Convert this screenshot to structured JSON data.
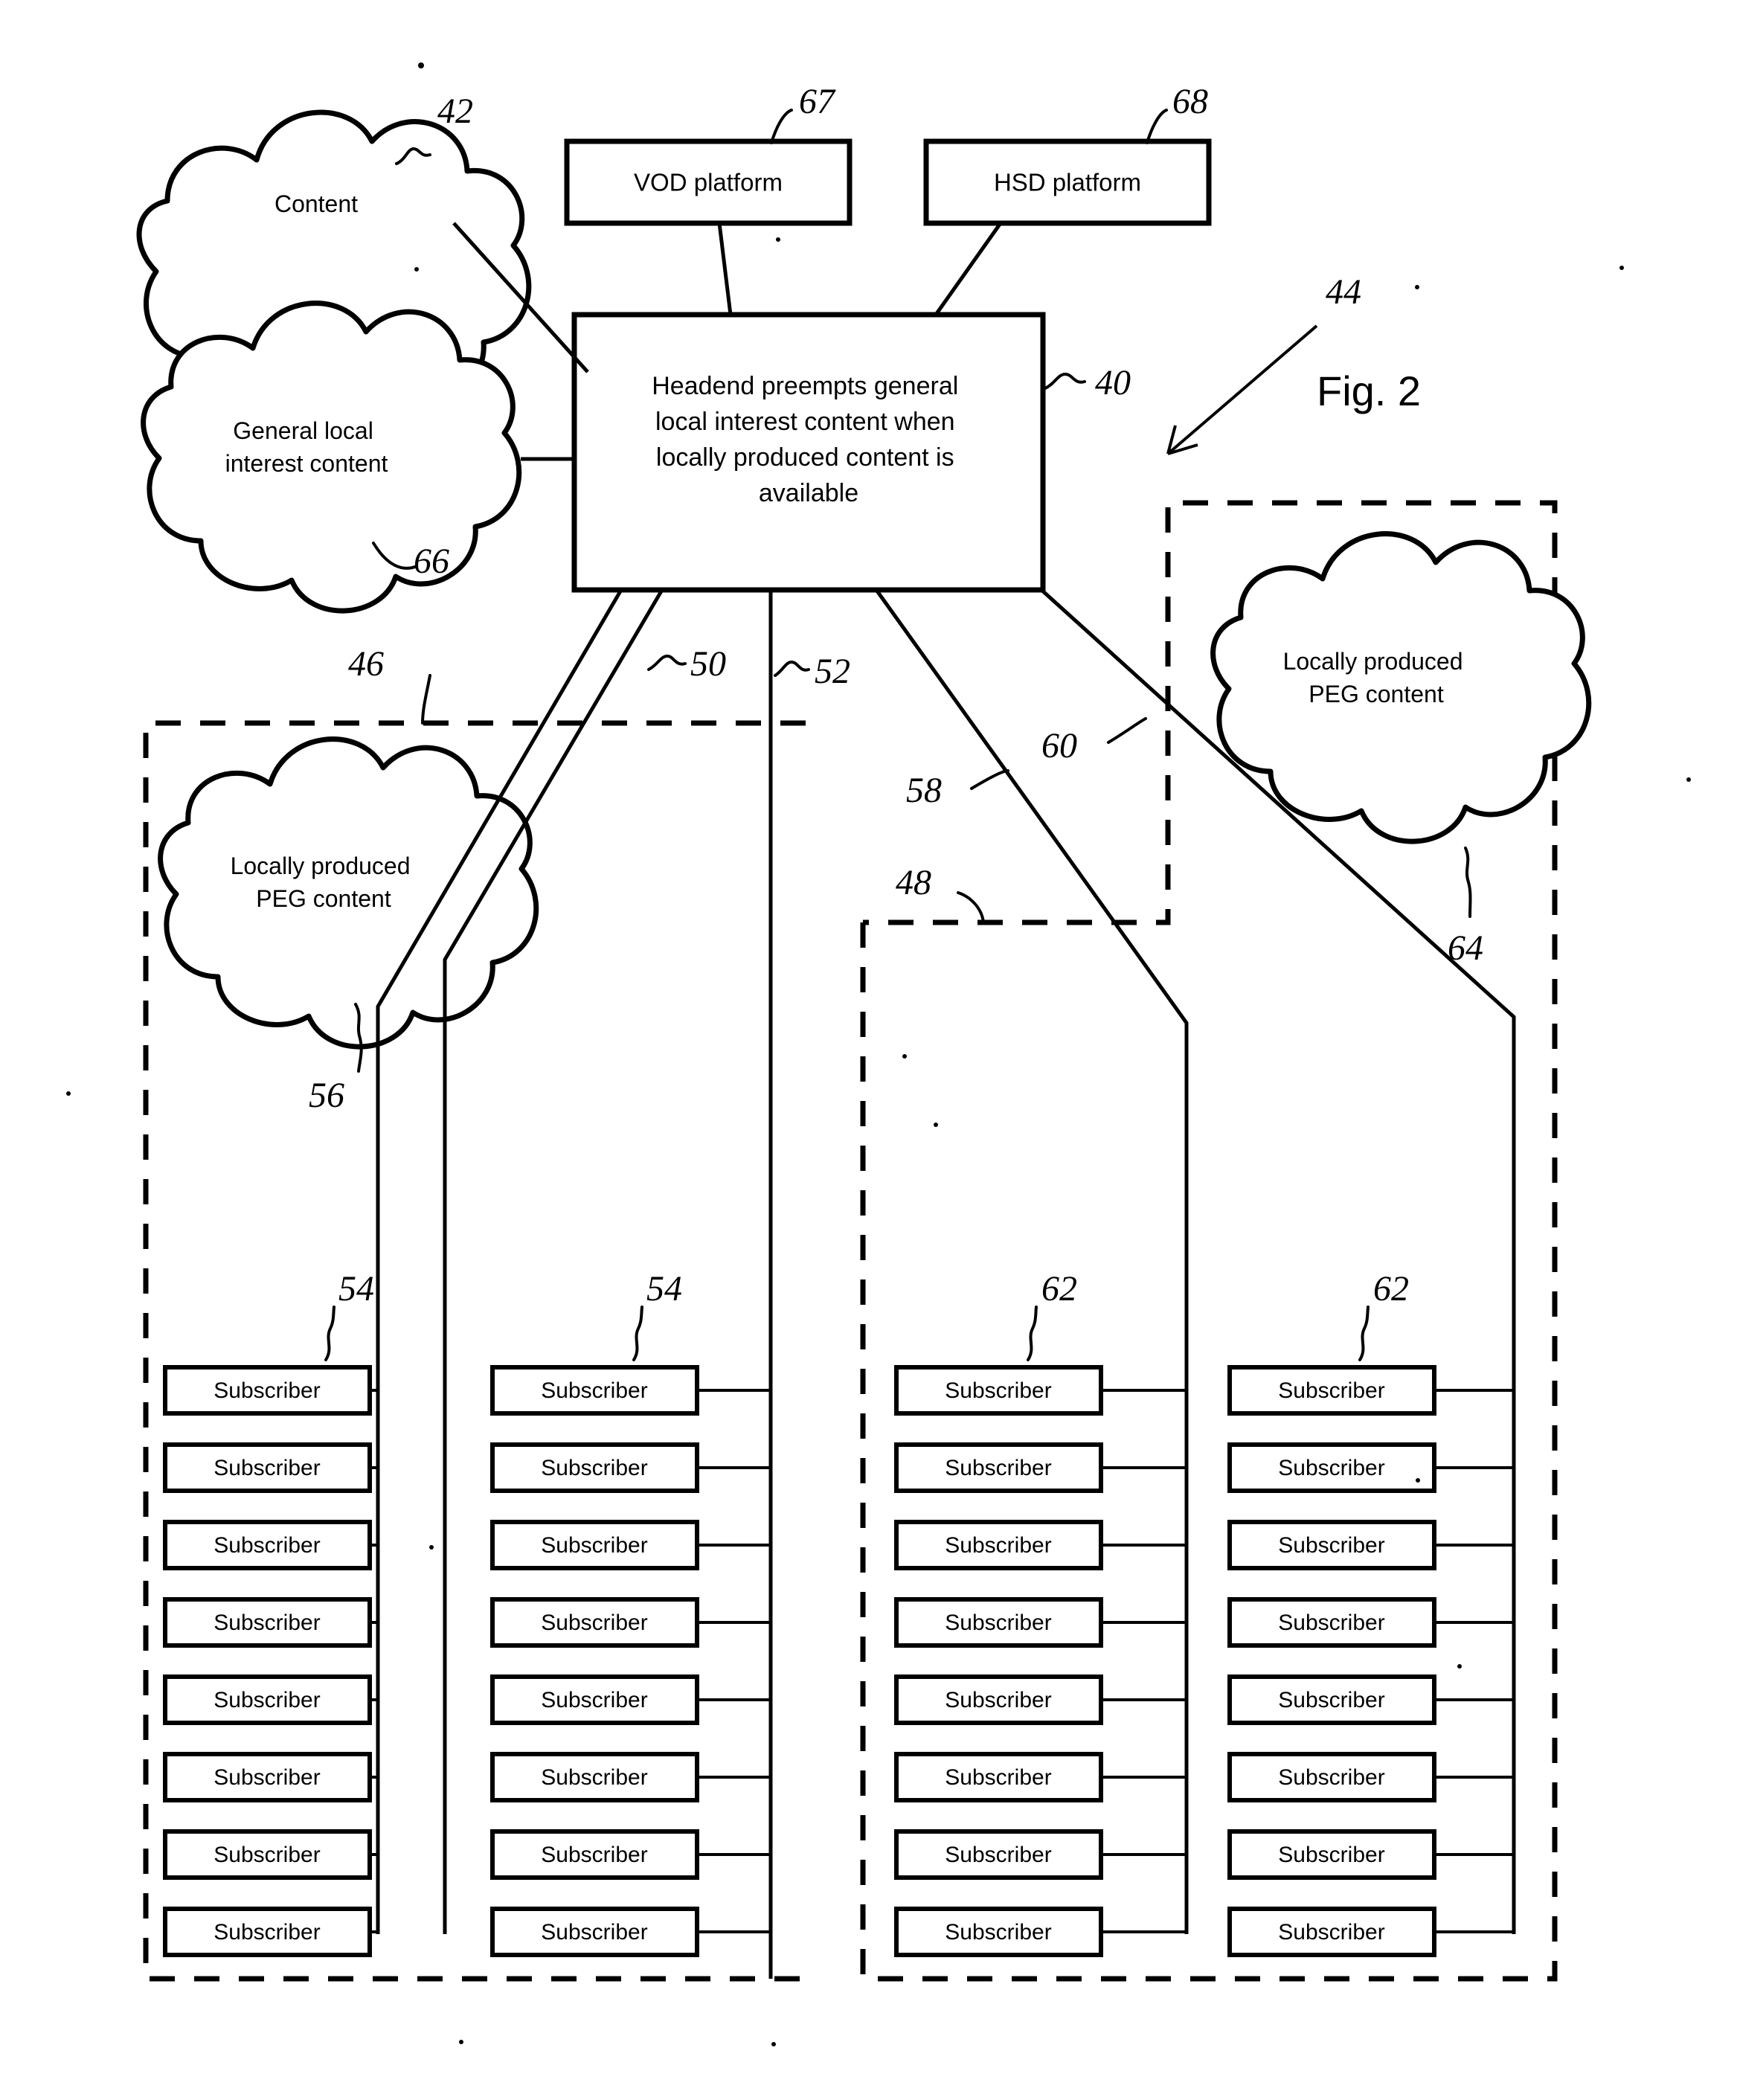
{
  "figure": {
    "label": "Fig. 2",
    "ref_overall": "44"
  },
  "clouds": [
    {
      "id": "content",
      "lines": [
        "Content"
      ],
      "ref": "42"
    },
    {
      "id": "general-local",
      "lines": [
        "General local",
        "interest content"
      ],
      "ref": "66"
    },
    {
      "id": "peg-left",
      "lines": [
        "Locally produced",
        "PEG content"
      ],
      "ref": "56"
    },
    {
      "id": "peg-right",
      "lines": [
        "Locally produced",
        "PEG content"
      ],
      "ref": "64"
    }
  ],
  "platforms": [
    {
      "id": "vod",
      "label": "VOD platform",
      "ref": "67"
    },
    {
      "id": "hsd",
      "label": "HSD platform",
      "ref": "68"
    }
  ],
  "headend": {
    "ref": "40",
    "lines": [
      "Headend preempts general",
      "local interest content when",
      "locally produced content is",
      "available"
    ]
  },
  "trunk_refs": [
    {
      "id": "trunk-50",
      "label": "50"
    },
    {
      "id": "trunk-52",
      "label": "52"
    },
    {
      "id": "trunk-58",
      "label": "58"
    },
    {
      "id": "trunk-60",
      "label": "60"
    }
  ],
  "group_refs": [
    {
      "id": "group-46",
      "label": "46"
    },
    {
      "id": "group-48",
      "label": "48"
    }
  ],
  "subscriber_columns": [
    {
      "id": "col-1",
      "ref": "54",
      "count": 8,
      "label": "Subscriber"
    },
    {
      "id": "col-2",
      "ref": "54",
      "count": 8,
      "label": "Subscriber"
    },
    {
      "id": "col-3",
      "ref": "62",
      "count": 8,
      "label": "Subscriber"
    },
    {
      "id": "col-4",
      "ref": "62",
      "count": 8,
      "label": "Subscriber"
    }
  ],
  "subscriber_label": "Subscriber",
  "colors": {
    "ink": "#000000",
    "paper": "#ffffff"
  }
}
